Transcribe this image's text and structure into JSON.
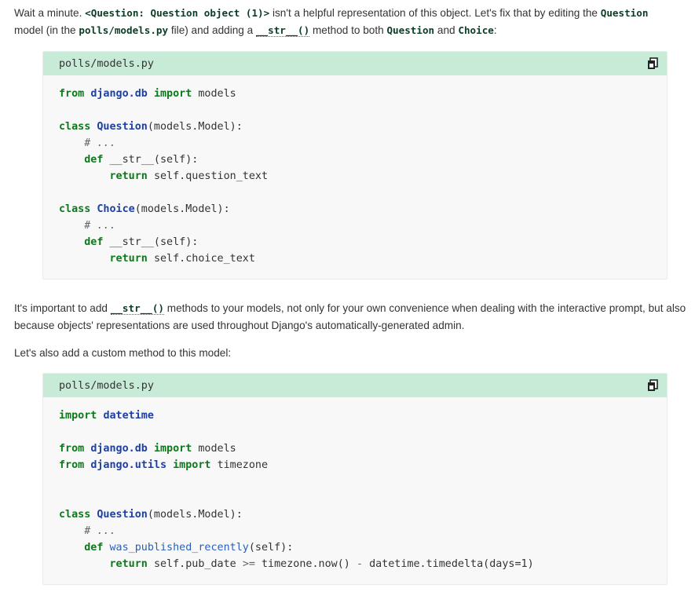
{
  "intro": {
    "t1": "Wait a minute. ",
    "c1": "<Question: Question object (1)>",
    "t2": " isn't a helpful representation of this object. Let's fix that by editing the ",
    "c2": "Question",
    "t3": "model (in the ",
    "c3": "polls/models.py",
    "t4": " file) and adding a ",
    "c4": "__str__()",
    "t5": " method to both ",
    "c5": "Question",
    "t6": " and ",
    "c6": "Choice",
    "t7": ":"
  },
  "snippet1": {
    "filename": "polls/models.py",
    "copy_icon": "copy-icon",
    "lines": {
      "l1": {
        "a": "from",
        "b": "django.db",
        "c": "import",
        "d": "models"
      },
      "l3": {
        "a": "class",
        "b": "Question",
        "c": "(models.Model):"
      },
      "l4": {
        "a": "# ..."
      },
      "l5": {
        "a": "def",
        "b": "__str__(self):"
      },
      "l6": {
        "a": "return",
        "b": "self.question_text"
      },
      "l8": {
        "a": "class",
        "b": "Choice",
        "c": "(models.Model):"
      },
      "l9": {
        "a": "# ..."
      },
      "l10": {
        "a": "def",
        "b": "__str__(self):"
      },
      "l11": {
        "a": "return",
        "b": "self.choice_text"
      }
    }
  },
  "middle": {
    "t1": "It's important to add ",
    "c1": "__str__()",
    "t2": " methods to your models, not only for your own convenience when dealing with the interactive prompt, but also because objects' representations are used throughout Django's automatically-generated admin."
  },
  "custom_method_text": "Let's also add a custom method to this model:",
  "snippet2": {
    "filename": "polls/models.py",
    "copy_icon": "copy-icon",
    "lines": {
      "l1": {
        "a": "import",
        "b": "datetime"
      },
      "l3": {
        "a": "from",
        "b": "django.db",
        "c": "import",
        "d": "models"
      },
      "l4": {
        "a": "from",
        "b": "django.utils",
        "c": "import",
        "d": "timezone"
      },
      "l7": {
        "a": "class",
        "b": "Question",
        "c": "(models.Model):"
      },
      "l8": {
        "a": "# ..."
      },
      "l9": {
        "a": "def",
        "b": "was_published_recently",
        "c": "(self):"
      },
      "l10": {
        "a": "return",
        "b": "self.pub_date",
        "c": ">=",
        "d": "timezone.now()",
        "e": "-",
        "f": "datetime.timedelta(days=1)"
      }
    }
  },
  "colors": {
    "header_bg": "#c8ebd8",
    "keyword": "#0c7a1a",
    "name": "#1c3fa8"
  }
}
